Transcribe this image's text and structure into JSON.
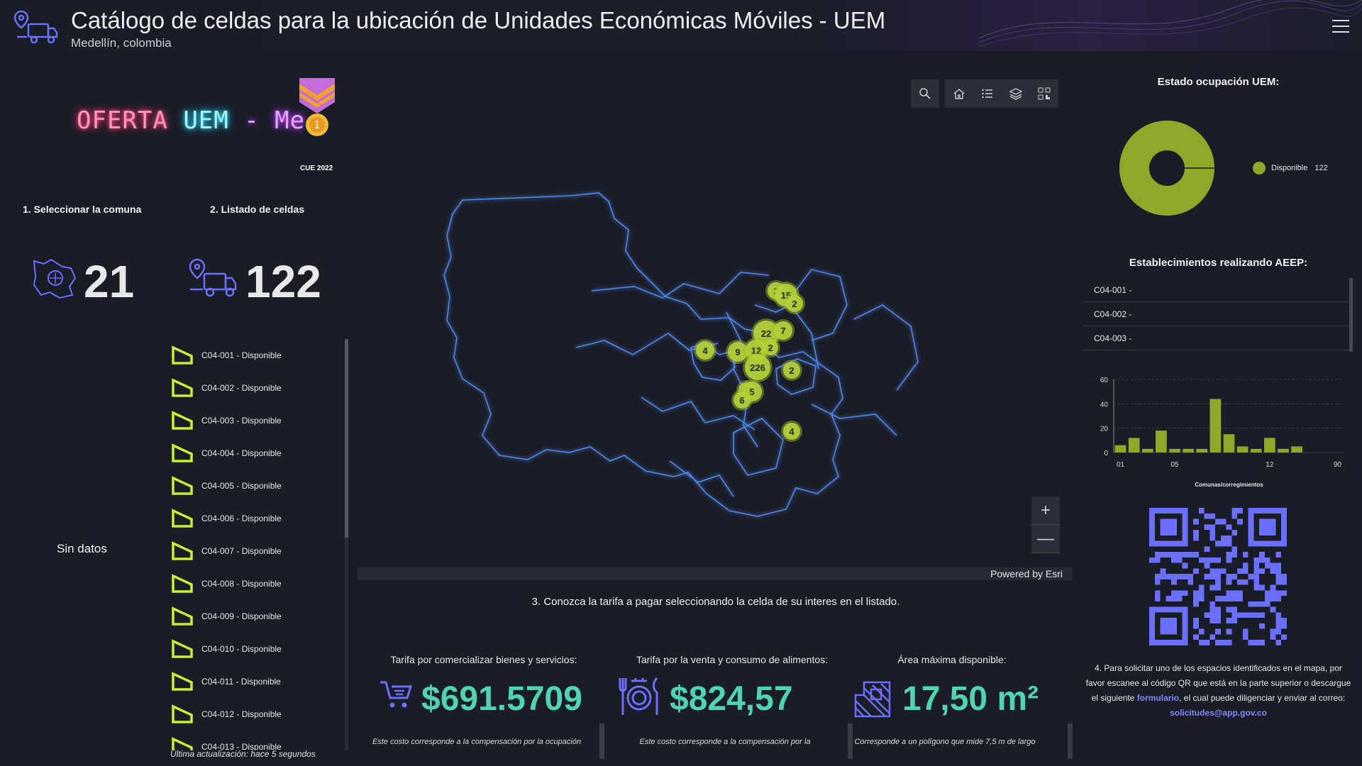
{
  "header": {
    "title": "Catálogo de celdas para la ubicación de Unidades Económicas Móviles - UEM",
    "subtitle": "Medellín, colombia",
    "menu_icon": "hamburger-menu-icon"
  },
  "left": {
    "neon_part1": "OFERTA",
    "neon_part2": "UEM",
    "neon_part3": "- Me",
    "badge_text": "CUE 2022",
    "step1_label": "1. Seleccionar la comuna",
    "step1_value": "21",
    "step2_label": "2. Listado de celdas",
    "step2_value": "122",
    "no_data": "Sin datos",
    "cells": [
      "C04-001 - Disponible",
      "C04-002 - Disponible",
      "C04-003 - Disponible",
      "C04-004 - Disponible",
      "C04-005 - Disponible",
      "C04-006 - Disponible",
      "C04-007 - Disponible",
      "C04-008 - Disponible",
      "C04-009 - Disponible",
      "C04-010 - Disponible",
      "C04-011 - Disponible",
      "C04-012 - Disponible",
      "C04-013 - Disponible"
    ],
    "last_update": "Última actualización: hace 5 segundos"
  },
  "map": {
    "clusters": [
      "2",
      "15",
      "2",
      "22",
      "7",
      "2",
      "4",
      "9",
      "12",
      "226",
      "2",
      "2",
      "5",
      "6",
      "4"
    ],
    "attribution": "Powered by Esri",
    "zoom_in": "+",
    "zoom_out": "—",
    "tools": [
      "search-icon",
      "home-icon",
      "list-icon",
      "layers-icon",
      "qr-grid-icon"
    ]
  },
  "step3": "3. Conozca la tarifa a pagar seleccionando la celda de su interes en el listado.",
  "kpis": [
    {
      "label": "Tarifa por comercializar bienes y servicios:",
      "value": "$691.5709",
      "note": "Este costo corresponde a la compensación por la ocupación"
    },
    {
      "label": "Tarifa por la venta y consumo de alimentos:",
      "value": "$824,57",
      "note": "Este costo corresponde a la compensación por la"
    },
    {
      "label": "Área máxima disponible:",
      "value": "17,50 m²",
      "note": "Corresponde a un polígono que mide 7,5 m  de largo"
    }
  ],
  "right": {
    "donut_title": "Estado ocupación UEM:",
    "legend_label": "Disponible",
    "legend_count": "122",
    "aeep_title": "Establecimientos realizando AEEP:",
    "aeep_items": [
      "C04-001 -",
      "C04-002 -",
      "C04-003 -"
    ],
    "step4_text1": "4. Para solicitar uno de los espacios identificados en el mapa, por favor escanee al  código QR  que está en la parte superior o descargue el siguiente ",
    "step4_link": "formulario",
    "step4_text2": ", el cual puede diligenciar y enviar al  correo: ",
    "step4_email": "solicitudes@app.gov.co"
  },
  "colors": {
    "accent": "#4fd3b0",
    "lime": "#c8f032",
    "donut": "#8fa829",
    "icon_blue": "#6b6fff"
  },
  "chart_data": {
    "type": "bar",
    "categories": [
      "01",
      "02",
      "03",
      "04",
      "05",
      "06",
      "07",
      "08",
      "09",
      "10",
      "11",
      "12",
      "13",
      "14",
      "15",
      "16",
      "90"
    ],
    "values": [
      6,
      12,
      3,
      18,
      3,
      3,
      3,
      44,
      15,
      5,
      3,
      12,
      3,
      5,
      0,
      0,
      0
    ],
    "xticks": [
      "01",
      "05",
      "12",
      "90"
    ],
    "yticks": [
      "0",
      "20",
      "40",
      "60"
    ],
    "xlabel": "Comunas/corregimientos",
    "ylabel": "",
    "ylim": [
      0,
      60
    ],
    "grid": true
  }
}
